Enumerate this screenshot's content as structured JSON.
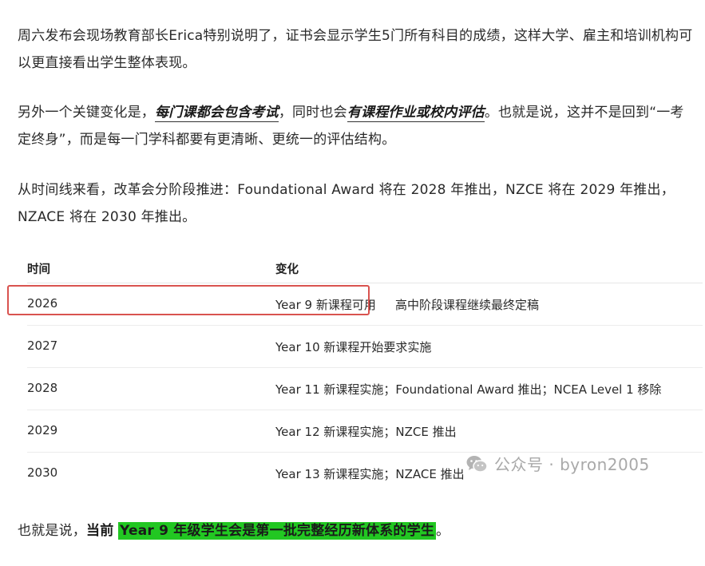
{
  "article": {
    "p1": "周六发布会现场教育部长Erica特别说明了，证书会显示学生5门所有科目的成绩，这样大学、雇主和培训机构可以更直接看出学生整体表现。",
    "p2": {
      "pre": "另外一个关键变化是，",
      "emph1": "每门课都会包含考试",
      "mid": "，同时也会",
      "emph2": "有课程作业或校内评估",
      "post": "。也就是说，这并不是回到“一考定终身”，而是每一门学科都要有更清晰、更统一的评估结构。"
    },
    "p3": "从时间线来看，改革会分阶段推进：Foundational Award 将在 2028 年推出，NZCE 将在 2029 年推出，NZACE 将在 2030 年推出。",
    "p4": {
      "pre": "也就是说，",
      "strong": "当前",
      "space": " ",
      "highlight": "Year 9 年级学生会是第一批完整经历新体系的学生",
      "post": "。"
    }
  },
  "timeline": {
    "headers": [
      "时间",
      "变化"
    ],
    "rows": [
      {
        "year": "2026",
        "change": "Year 9 新课程可用",
        "note": "高中阶段课程继续最终定稿"
      },
      {
        "year": "2027",
        "change": "Year 10 新课程开始要求实施",
        "note": ""
      },
      {
        "year": "2028",
        "change": "Year 11 新课程实施；Foundational Award 推出；NCEA Level 1 移除",
        "note": ""
      },
      {
        "year": "2029",
        "change": "Year 12 新课程实施；NZCE 推出",
        "note": ""
      },
      {
        "year": "2030",
        "change": "Year 13 新课程实施；NZACE 推出",
        "note": ""
      }
    ]
  },
  "watermark": {
    "icon": "wechat-icon",
    "text": "公众号 · byron2005"
  },
  "colors": {
    "highlight": "#22c722",
    "red_box": "#d9534f",
    "text": "#2a2a2a",
    "watermark": "#a9a9a9"
  }
}
